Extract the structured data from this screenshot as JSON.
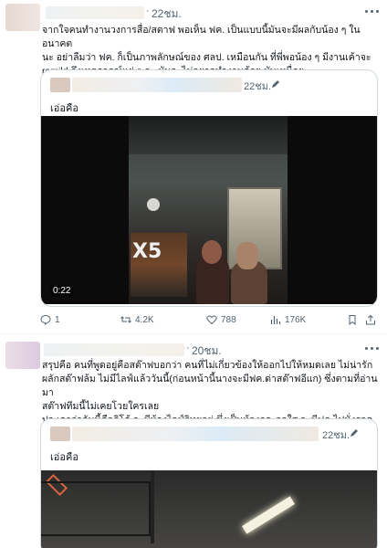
{
  "posts": [
    {
      "time": "22ชม.",
      "text": "จากใจคนทำงานวงการสื่อ/สตาฟ พอเห็น ฟค. เป็นแบบนี้มันจะมีผลกับน้อง ๆ ในอนาคต\nนะ อย่าลืมว่า ฟค. ก็เป็นภาพลักษณ์ของ ศลป. เหมือนกัน ที่พี่พอน้อง ๆ มีงานเค้าจะ\nremild ถึงเหตุการณ์แย่ ๆ อะ มันจะไม่อยากทำงานด้วย มันเหนื่อย",
      "quote": {
        "time": "22ชม.",
        "text": "เอ่อคือ",
        "video_time": "0:22",
        "scene_label": "X5"
      },
      "actions": {
        "reply_count": "1",
        "retweet_count": "4.2K",
        "like_count": "788",
        "view_count": "176K"
      }
    },
    {
      "time": "20ชม.",
      "text": "สรุปคือ คนที่พูดอยู่คือสต๊าฟบอกว่า คนที่ไม่เกี่ยวข้องให้ออกไปให้หมดเลย ไม่น่ารัก\nผลักสต๊าฟล้ม ไม่มีไลฟ์แล้ววันนี้(ก่อนหน้านี้นางจะมีฟค.ด่าสต๊าฟอีแก) ซึ่งตามที่อ่านมา\nสต๊าฟทีมนี้ไม่เคยโวยใครเลย\nปล.เดาว่าอันนี้คือลิโด้ จะมีห้องไลฟ์วิทยุอยู่ ซึ่งเป็นห้องกระจกใส จะมีฟค.ไปนั่งรอดูกัน",
      "quote": {
        "time": "22ชม.",
        "text": "เอ่อคือ"
      }
    }
  ]
}
